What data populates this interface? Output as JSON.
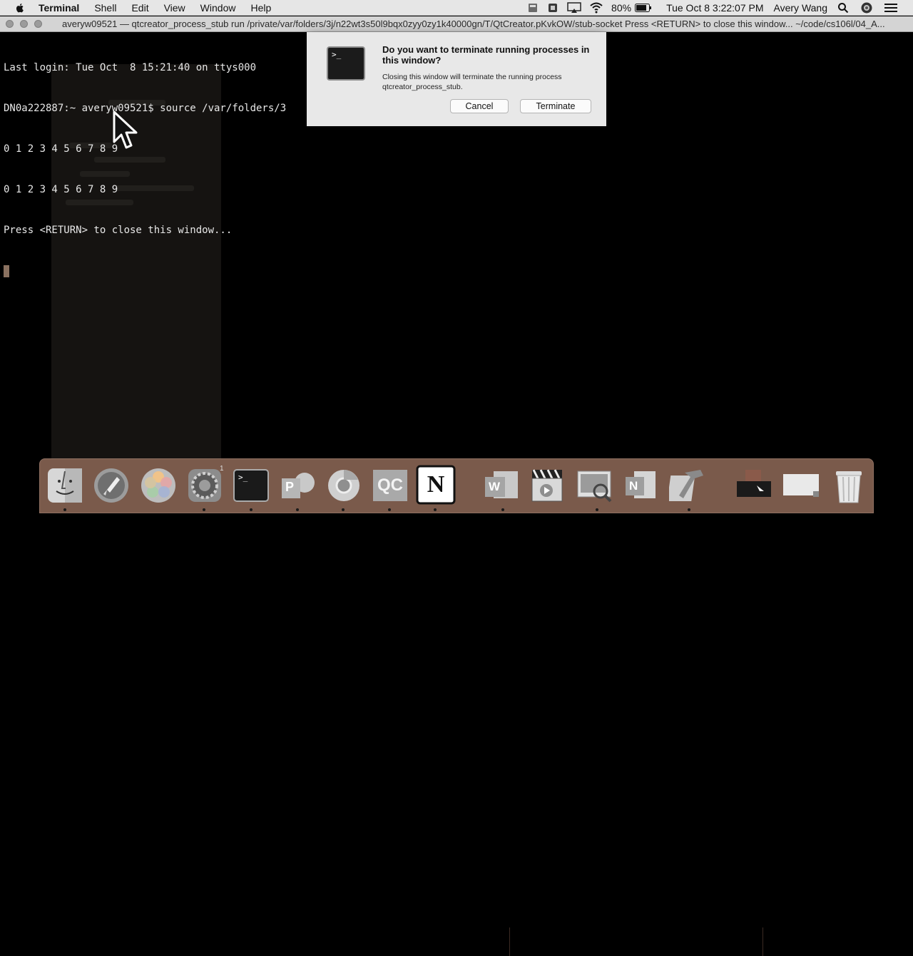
{
  "menubar": {
    "app_name": "Terminal",
    "menus": [
      "Shell",
      "Edit",
      "View",
      "Window",
      "Help"
    ],
    "battery_percent": "80%",
    "datetime": "Tue Oct 8  3:22:07 PM",
    "user_name": "Avery Wang",
    "icons": [
      "apple-icon",
      "finder-sync-icon",
      "vpn-icon",
      "airplay-icon",
      "wifi-icon",
      "battery-icon",
      "spotlight-icon",
      "siri-icon",
      "notification-center-icon"
    ]
  },
  "window": {
    "title": "averyw09521 — qtcreator_process_stub run /private/var/folders/3j/n22wt3s50l9bqx0zyy0zy1k40000gn/T/QtCreator.pKvkOW/stub-socket Press <RETURN> to close this window... ~/code/cs106l/04_A..."
  },
  "terminal": {
    "lines": [
      "Last login: Tue Oct  8 15:21:40 on ttys000",
      "DN0a222887:~ averyw09521$ source /var/folders/3",
      "0 1 2 3 4 5 6 7 8 9",
      "0 1 2 3 4 5 6 7 8 9",
      "Press <RETURN> to close this window..."
    ]
  },
  "dialog": {
    "title": "Do you want to terminate running processes in this window?",
    "message": "Closing this window will terminate the running process qtcreator_process_stub.",
    "cancel_label": "Cancel",
    "terminate_label": "Terminate",
    "icon_text": ">_"
  },
  "dock": {
    "items": [
      {
        "name": "finder"
      },
      {
        "name": "launchpad"
      },
      {
        "name": "photos"
      },
      {
        "name": "system-preferences",
        "badge": "1"
      },
      {
        "name": "terminal",
        "label": ">_"
      },
      {
        "name": "powerpoint",
        "label": "P"
      },
      {
        "name": "chrome"
      },
      {
        "name": "qt-creator",
        "label": "QC"
      },
      {
        "name": "notion",
        "label": "N"
      },
      {
        "name": "word",
        "label": "W"
      },
      {
        "name": "imovie"
      },
      {
        "name": "preview"
      },
      {
        "name": "onenote",
        "label": "N"
      },
      {
        "name": "xcode"
      },
      {
        "name": "downloads-stack"
      },
      {
        "name": "documents-stack"
      },
      {
        "name": "trash"
      }
    ]
  }
}
